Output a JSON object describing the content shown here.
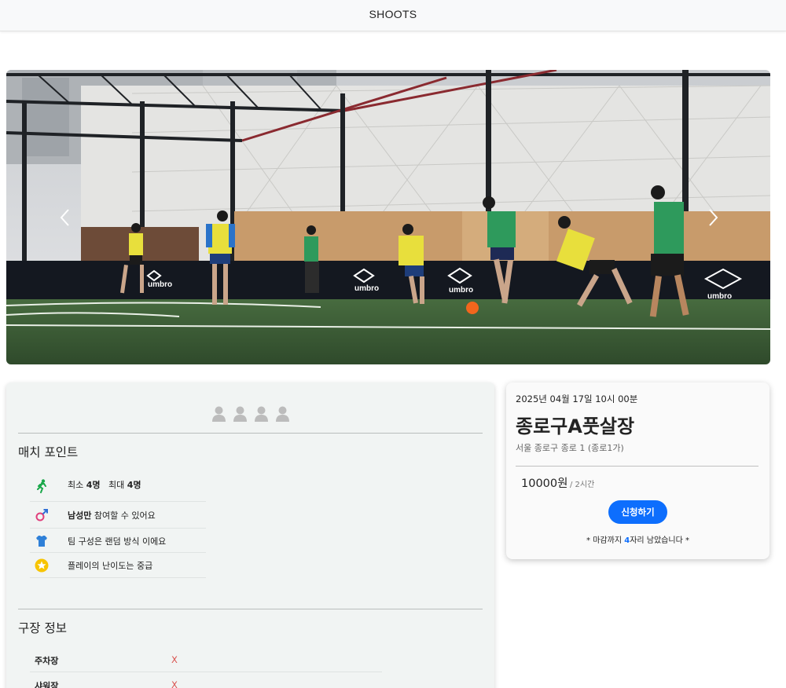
{
  "header": {
    "brand": "SHOOTS"
  },
  "hero": {
    "image": "futsal-players-photo",
    "prev_icon": "chevron-left-icon",
    "next_icon": "chevron-right-icon"
  },
  "participants": {
    "icon": "person-icon",
    "count": 4
  },
  "match_points": {
    "title": "매치 포인트",
    "items": [
      {
        "icon": "running-person-icon",
        "min_label": "최소",
        "min_value": "4명",
        "max_label": "최대",
        "max_value": "4명"
      },
      {
        "icon": "gender-male-icon",
        "text_bold": "남성만",
        "text": " 참여할 수 있어요"
      },
      {
        "icon": "jersey-icon",
        "text": "팀 구성은 랜덤 방식 이에요"
      },
      {
        "icon": "star-badge-icon",
        "text": "플레이의 난이도는 중급"
      }
    ]
  },
  "stadium_info": {
    "title": "구장 정보",
    "rows": [
      {
        "label": "주차장",
        "value": "X"
      },
      {
        "label": "샤워장",
        "value": "X"
      }
    ]
  },
  "booking": {
    "datetime": "2025년 04월 17일 10시 00분",
    "venue": "종로구A풋살장",
    "address": "서울 종로구 종로 1 (종로1가)",
    "price": "10000원",
    "price_unit": "/ 2시간",
    "apply_button": "신청하기",
    "note_prefix": "* 마감까지 ",
    "note_count": "4",
    "note_suffix": "자리 남았습니다 *"
  },
  "colors": {
    "accent": "#0d6efd",
    "unavailable": "#d9534f",
    "card_bg": "#f1f4f3"
  }
}
